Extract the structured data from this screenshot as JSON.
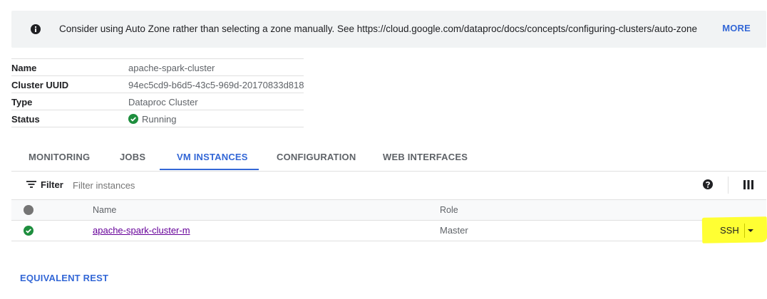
{
  "banner": {
    "icon": "info-icon",
    "message": "Consider using Auto Zone rather than selecting a zone manually. See https://cloud.google.com/dataproc/docs/concepts/configuring-clusters/auto-zone",
    "more_label": "MORE"
  },
  "details": [
    {
      "key": "Name",
      "value": "apache-spark-cluster"
    },
    {
      "key": "Cluster UUID",
      "value": "94ec5cd9-b6d5-43c5-969d-20170833d818"
    },
    {
      "key": "Type",
      "value": "Dataproc Cluster"
    },
    {
      "key": "Status",
      "value": "Running",
      "icon": "check-circle-icon",
      "status_color": "#1e8e3e"
    }
  ],
  "tabs": [
    {
      "label": "MONITORING",
      "active": false
    },
    {
      "label": "JOBS",
      "active": false
    },
    {
      "label": "VM INSTANCES",
      "active": true
    },
    {
      "label": "CONFIGURATION",
      "active": false
    },
    {
      "label": "WEB INTERFACES",
      "active": false
    }
  ],
  "toolbar": {
    "filter_label": "Filter",
    "filter_placeholder": "Filter instances",
    "icons": [
      "filter-icon",
      "help-icon",
      "columns-icon"
    ]
  },
  "table": {
    "columns": [
      "Name",
      "Role"
    ],
    "rows": [
      {
        "name": "apache-spark-cluster-m",
        "role": "Master",
        "status": "running",
        "action": "SSH"
      }
    ]
  },
  "footer": {
    "rest_label": "EQUIVALENT REST"
  },
  "colors": {
    "accent": "#3367d6",
    "success": "#1e8e3e",
    "highlight": "#ffff33",
    "visited_link": "#660099"
  }
}
